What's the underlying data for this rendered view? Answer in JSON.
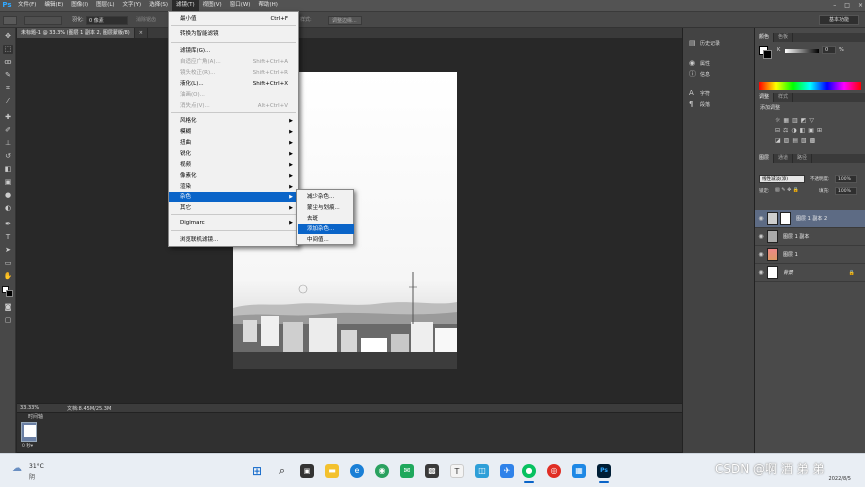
{
  "menubar": {
    "logo": "Ps",
    "items": [
      "文件(F)",
      "编辑(E)",
      "图像(I)",
      "图层(L)",
      "文字(Y)",
      "选择(S)",
      "滤镜(T)",
      "视图(V)",
      "窗口(W)",
      "帮助(H)"
    ],
    "active_index": 6,
    "window_controls": [
      "–",
      "□",
      "×"
    ]
  },
  "options_bar": {
    "feather_label": "羽化:",
    "feather_value": "0 像素",
    "antialias_label": "消除锯齿",
    "style_label": "样式:",
    "refine_edge_label": "调整边缘...",
    "workspace_label": "基本功能"
  },
  "doc_tabs": [
    {
      "label": "未标题-1 @ 33.3% (图层 1 副本 2, 图层蒙版/8)",
      "active": true
    },
    {
      "label": "× ",
      "active": false
    }
  ],
  "filter_menu": {
    "items": [
      {
        "label": "最小值",
        "shortcut": "Ctrl+F",
        "disabled": false,
        "submenu": false
      },
      {
        "label": "转换为智能滤镜",
        "shortcut": "",
        "disabled": false,
        "submenu": false
      },
      {
        "label": "滤镜库(G)...",
        "shortcut": "",
        "disabled": false,
        "submenu": false
      },
      {
        "label": "自适应广角(A)...",
        "shortcut": "Shift+Ctrl+A",
        "disabled": true,
        "submenu": false
      },
      {
        "label": "镜头校正(R)...",
        "shortcut": "Shift+Ctrl+R",
        "disabled": true,
        "submenu": false
      },
      {
        "label": "液化(L)...",
        "shortcut": "Shift+Ctrl+X",
        "disabled": false,
        "submenu": false
      },
      {
        "label": "油画(O)...",
        "shortcut": "",
        "disabled": true,
        "submenu": false
      },
      {
        "label": "消失点(V)...",
        "shortcut": "Alt+Ctrl+V",
        "disabled": true,
        "submenu": false
      },
      {
        "label": "风格化",
        "shortcut": "",
        "disabled": false,
        "submenu": true
      },
      {
        "label": "模糊",
        "shortcut": "",
        "disabled": false,
        "submenu": true
      },
      {
        "label": "扭曲",
        "shortcut": "",
        "disabled": false,
        "submenu": true
      },
      {
        "label": "锐化",
        "shortcut": "",
        "disabled": false,
        "submenu": true
      },
      {
        "label": "视频",
        "shortcut": "",
        "disabled": false,
        "submenu": true
      },
      {
        "label": "像素化",
        "shortcut": "",
        "disabled": false,
        "submenu": true
      },
      {
        "label": "渲染",
        "shortcut": "",
        "disabled": false,
        "submenu": true
      },
      {
        "label": "杂色",
        "shortcut": "",
        "disabled": false,
        "submenu": true,
        "highlighted": true
      },
      {
        "label": "其它",
        "shortcut": "",
        "disabled": false,
        "submenu": true
      },
      {
        "label": "Digimarc",
        "shortcut": "",
        "disabled": false,
        "submenu": true
      },
      {
        "label": "浏览联机滤镜...",
        "shortcut": "",
        "disabled": false,
        "submenu": false
      }
    ]
  },
  "noise_submenu": {
    "items": [
      {
        "label": "减少杂色..."
      },
      {
        "label": "蒙尘与划痕..."
      },
      {
        "label": "去斑"
      },
      {
        "label": "添加杂色...",
        "highlighted": true
      },
      {
        "label": "中间值..."
      }
    ]
  },
  "dock": {
    "items": [
      {
        "label": "历史记录",
        "icon": "history-icon"
      },
      {
        "label": "属性",
        "icon": "properties-icon"
      },
      {
        "label": "信息",
        "icon": "info-icon"
      },
      {
        "label": "字符",
        "icon": "character-icon"
      },
      {
        "label": "段落",
        "icon": "paragraph-icon"
      }
    ]
  },
  "color_panel": {
    "tabs": [
      "颜色",
      "色板"
    ],
    "k_label": "K",
    "k_value": "0",
    "k_unit": "%"
  },
  "adjust_panel": {
    "tabs": [
      "调整",
      "样式"
    ],
    "title": "添加调整"
  },
  "layers_panel": {
    "tabs": [
      "图层",
      "通道",
      "路径"
    ],
    "blend_mode": "线性减淡(添)",
    "opacity_label": "不透明度:",
    "opacity_value": "100%",
    "lock_label": "锁定:",
    "fill_label": "填充:",
    "fill_value": "100%",
    "layers": [
      {
        "name": "图层 1 副本 2",
        "selected": true
      },
      {
        "name": "图层 1 副本",
        "selected": false
      },
      {
        "name": "图层 1",
        "selected": false
      },
      {
        "name": "背景",
        "selected": false
      }
    ]
  },
  "status": {
    "zoom": "33.33%",
    "doc_info": "文档:8.45M/25.3M"
  },
  "timeline": {
    "title": "时间轴",
    "frame_time": "0 秒▾",
    "loop_label": "永远"
  },
  "taskbar": {
    "weather_temp": "31°C",
    "weather_desc": "阴",
    "date": "2022/8/5"
  },
  "watermark": "CSDN @啊 酒 弟 弟"
}
